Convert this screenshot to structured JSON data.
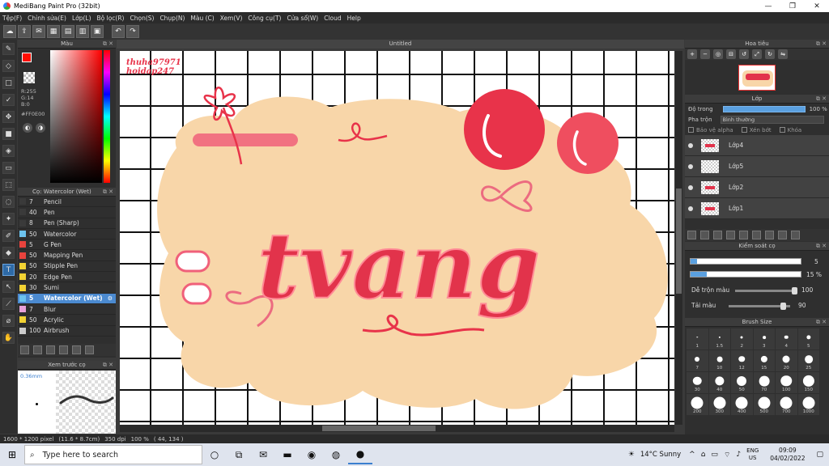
{
  "window": {
    "title": "MediBang Paint Pro (32bit)",
    "minimize": "—",
    "maximize": "❐",
    "close": "✕"
  },
  "menu": [
    "Tệp(F)",
    "Chỉnh sửa(E)",
    "Lớp(L)",
    "Bộ lọc(R)",
    "Chọn(S)",
    "Chụp(N)",
    "Màu (C)",
    "Xem(V)",
    "Công cụ(T)",
    "Cửa sổ(W)",
    "Cloud",
    "Help"
  ],
  "color_panel": {
    "title": "Màu",
    "r": "R:255",
    "g": "G:14",
    "b": "B:0",
    "hex": "#FF0E00",
    "fg": "#ff0e00"
  },
  "brush_panel": {
    "title": "Cọ: Watercolor (Wet)",
    "brushes": [
      {
        "size": "7",
        "name": "Pencil",
        "color": "#3a3a3a"
      },
      {
        "size": "40",
        "name": "Pen",
        "color": "#3a3a3a"
      },
      {
        "size": "8",
        "name": "Pen (Sharp)",
        "color": "#3a3a3a"
      },
      {
        "size": "50",
        "name": "Watercolor",
        "color": "#6cc3ee"
      },
      {
        "size": "5",
        "name": "G Pen",
        "color": "#e8433d"
      },
      {
        "size": "50",
        "name": "Mapping Pen",
        "color": "#e8433d"
      },
      {
        "size": "50",
        "name": "Stipple Pen",
        "color": "#f2d233"
      },
      {
        "size": "20",
        "name": "Edge Pen",
        "color": "#f2d233"
      },
      {
        "size": "30",
        "name": "Sumi",
        "color": "#f2d233"
      },
      {
        "size": "5",
        "name": "Watercolor (Wet)",
        "color": "#6cc3ee"
      },
      {
        "size": "7",
        "name": "Blur",
        "color": "#e7a0d8"
      },
      {
        "size": "50",
        "name": "Acrylic",
        "color": "#f2d233"
      },
      {
        "size": "100",
        "name": "Airbrush",
        "color": "#cccccc"
      }
    ]
  },
  "preview_panel": {
    "title": "Xem trước cọ",
    "size": "0.36mm"
  },
  "canvas": {
    "tab": "Untitled",
    "watermark_1": "thuha97971",
    "watermark_2": "hoidap247",
    "art_word": "tvang"
  },
  "status": {
    "size": "1600 * 1200 pixel",
    "cm": "(11.6 * 8.7cm)",
    "dpi": "350 dpi",
    "zoom": "100 %",
    "coords": "( 44, 134 )"
  },
  "navigator": {
    "title": "Hoa tiêu"
  },
  "layers": {
    "title": "Lớp",
    "opacity_label": "Độ trong",
    "opacity_value": "100 %",
    "blend_label": "Pha trộn",
    "blend_value": "Bình thường",
    "protect_alpha": "Bảo vệ alpha",
    "clipping": "Xén bớt",
    "lock": "Khóa",
    "items": [
      "Lớp4",
      "Lớp5",
      "Lớp2",
      "Lớp1"
    ]
  },
  "brush_control": {
    "title": "Kiểm soát cọ",
    "size_value": "5",
    "opacity_value": "15 %",
    "opacity_fraction": 0.15,
    "mix_label": "Dễ trộn màu",
    "mix_value": "100",
    "load_label": "Tải màu",
    "load_value": "90"
  },
  "brush_size": {
    "title": "Brush Size",
    "sizes": [
      "1",
      "1.5",
      "2",
      "3",
      "4",
      "5",
      "7",
      "10",
      "12",
      "15",
      "20",
      "25",
      "30",
      "40",
      "50",
      "70",
      "100",
      "150",
      "200",
      "300",
      "400",
      "500",
      "700",
      "1000"
    ]
  },
  "taskbar": {
    "search_placeholder": "Type here to search",
    "weather": "14°C  Sunny",
    "lang_1": "ENG",
    "lang_2": "US",
    "time": "09:09",
    "date": "04/02/2022"
  }
}
